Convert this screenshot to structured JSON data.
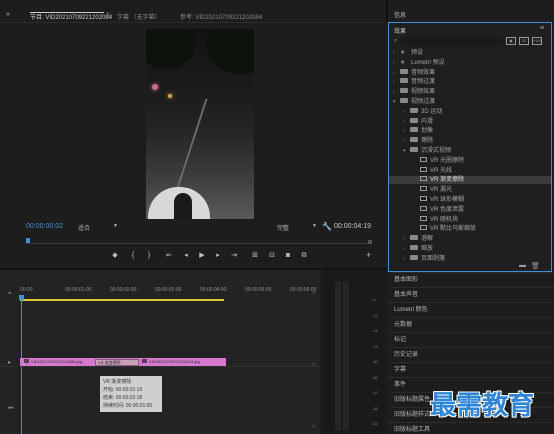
{
  "monitor": {
    "tabs": [
      {
        "label": "节目: VID20210709221202084"
      },
      {
        "label": "字幕 （无字幕）"
      },
      {
        "label": "参考: VID20210709221202084"
      }
    ],
    "timecode_current": "00:00:00:02",
    "fit_option": "适合",
    "resolution_option": "完整",
    "timecode_duration": "00:00:04:19",
    "transport_icons": [
      "marker-icon",
      "mark-in-icon",
      "mark-out-icon",
      "go-to-in-icon",
      "step-back-icon",
      "play-icon",
      "step-forward-icon",
      "go-to-out-icon",
      "lift-icon",
      "extract-icon",
      "export-frame-icon",
      "compare-icon"
    ]
  },
  "info_panel": {
    "title": "信息"
  },
  "effects_panel": {
    "title": "效果",
    "search_placeholder": "",
    "items": [
      {
        "label": "预设",
        "kind": "folder-star"
      },
      {
        "label": "Lumetri 预设",
        "kind": "folder-star"
      },
      {
        "label": "音频效果",
        "kind": "folder"
      },
      {
        "label": "音频过渡",
        "kind": "folder"
      },
      {
        "label": "视频效果",
        "kind": "folder"
      },
      {
        "label": "视频过渡",
        "kind": "folder",
        "expanded": true
      },
      {
        "label": "3D 运动",
        "kind": "folder"
      },
      {
        "label": "内滑",
        "kind": "folder"
      },
      {
        "label": "划像",
        "kind": "folder"
      },
      {
        "label": "擦除",
        "kind": "folder"
      },
      {
        "label": "沉浸式视频",
        "kind": "folder",
        "expanded": true
      },
      {
        "label": "VR 光圈擦除",
        "kind": "effect"
      },
      {
        "label": "VR 光线",
        "kind": "effect"
      },
      {
        "label": "VR 渐变擦除",
        "kind": "effect",
        "selected": true
      },
      {
        "label": "VR 漏光",
        "kind": "effect"
      },
      {
        "label": "VR 球形模糊",
        "kind": "effect"
      },
      {
        "label": "VR 色度泄露",
        "kind": "effect"
      },
      {
        "label": "VR 随机块",
        "kind": "effect"
      },
      {
        "label": "VR 默比乌斯缩放",
        "kind": "effect"
      },
      {
        "label": "溶解",
        "kind": "folder"
      },
      {
        "label": "缩放",
        "kind": "folder"
      },
      {
        "label": "页面剥落",
        "kind": "folder"
      }
    ]
  },
  "side_panels": [
    "基本图形",
    "基本声音",
    "Lumetri 颜色",
    "元数据",
    "标记",
    "历史记录",
    "字幕",
    "事件",
    "旧版标题属性",
    "旧版标题样式",
    "旧版标题工具"
  ],
  "timeline": {
    "ruler_labels": [
      "00:00",
      "00:00:01:00",
      "00:00:02:00",
      "00:00:03:00",
      "00:00:04:00",
      "00:00:05:00",
      "00:00:06:00"
    ],
    "clip_a": "VID20210709221202084.jpg",
    "transition_label": "VR 渐变擦除",
    "clip_b": "VID20210709221202203.jpg",
    "tooltip": {
      "name": "VR 渐变擦除",
      "start": "开始: 00:00:01:19",
      "end": "结束: 00:00:02:18",
      "duration": "持续时间: 00:00:01:00"
    }
  },
  "meters": {
    "db_labels": [
      "-6",
      "-12",
      "-18",
      "-24",
      "-30",
      "-36",
      "-42",
      "-48",
      "-54"
    ]
  },
  "watermark": "最需教育",
  "colors": {
    "accent": "#3f8fe0",
    "clip": "#d778cf",
    "work_area": "#d6c82f",
    "watermark": "#2f86d7"
  }
}
